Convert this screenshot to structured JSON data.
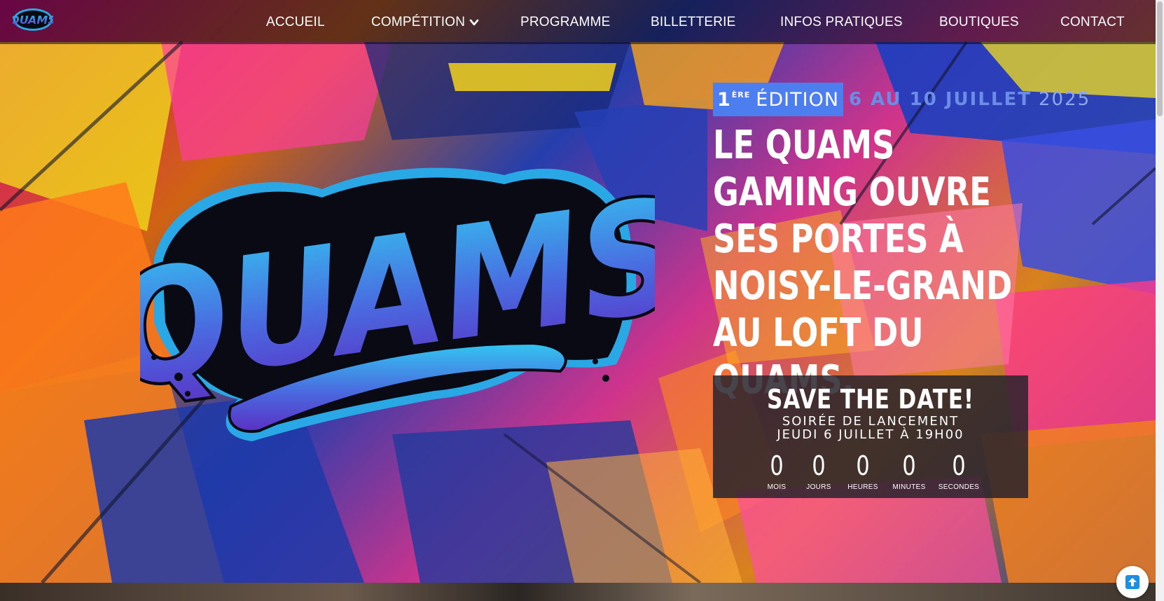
{
  "colors": {
    "accent_blue": "#4d7ef0",
    "date_blue": "#6a8de8",
    "nav_bg": "rgba(10,10,25,0.55)",
    "logo_gradient_top": "#33c6f0",
    "logo_gradient_bottom": "#5b2fc4"
  },
  "nav": {
    "logo_icon": "quams-logo-icon",
    "items": [
      {
        "label": "ACCUEIL"
      },
      {
        "label": "COMPÉTITION",
        "icon": "chevron-down-icon"
      },
      {
        "label": "PROGRAMME"
      },
      {
        "label": "BILLETTERIE"
      },
      {
        "label": "INFOS PRATIQUES"
      },
      {
        "label": "BOUTIQUES"
      },
      {
        "label": "CONTACT"
      }
    ]
  },
  "hero": {
    "logo_text": "QUAMS",
    "edition": {
      "number": "1",
      "sup": "ÈRE",
      "word": "ÉDITION",
      "dates": "6 AU 10 JUILLET",
      "year": "2025"
    },
    "headline": "LE QUAMS GAMING OUVRE SES PORTES À NOISY-LE-GRAND AU LOFT DU QUAMS."
  },
  "countdown": {
    "title": "SAVE THE DATE!",
    "line1": "SOIRÉE DE LANCEMENT",
    "line2": "JEUDI 6 JUILLET À 19H00",
    "units": [
      {
        "value": "0",
        "label": "MOIS"
      },
      {
        "value": "0",
        "label": "JOURS"
      },
      {
        "value": "0",
        "label": "HEURES"
      },
      {
        "value": "0",
        "label": "MINUTES"
      },
      {
        "value": "0",
        "label": "SECONDES"
      }
    ]
  },
  "back_to_top_icon": "arrow-up-icon"
}
